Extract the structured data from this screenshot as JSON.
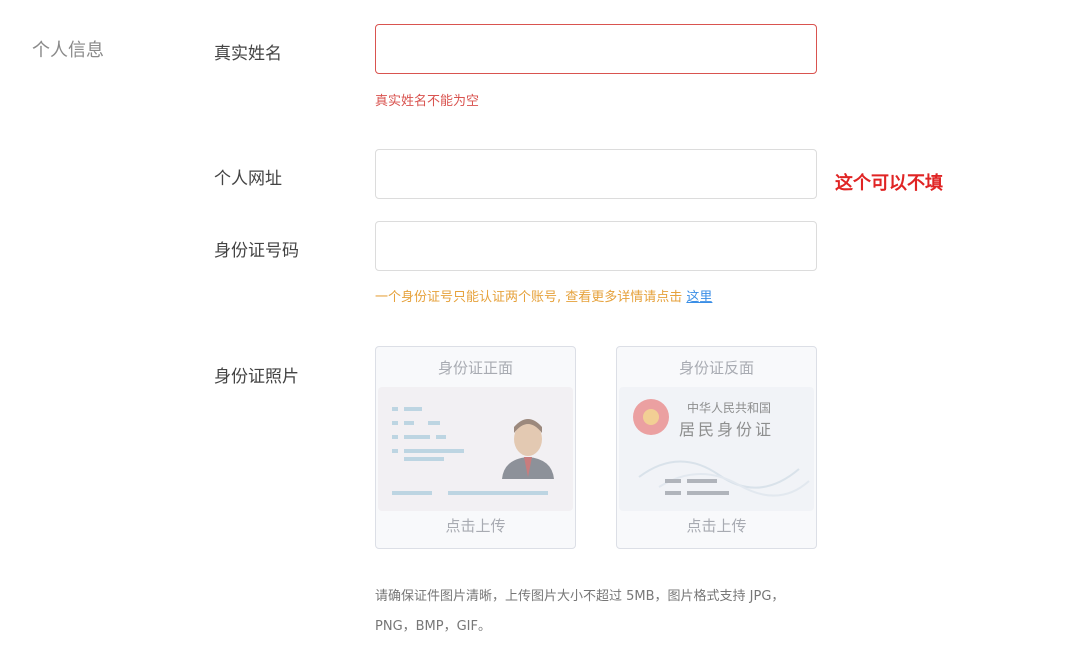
{
  "section": {
    "title": "个人信息"
  },
  "fields": {
    "real_name": {
      "label": "真实姓名",
      "value": "",
      "error": "真实姓名不能为空"
    },
    "website": {
      "label": "个人网址",
      "value": "",
      "annotation": "这个可以不填"
    },
    "id_number": {
      "label": "身份证号码",
      "value": "",
      "hint_text": "一个身份证号只能认证两个账号, 查看更多详情请点击",
      "hint_link": "这里"
    },
    "id_photos": {
      "label": "身份证照片",
      "front": {
        "title": "身份证正面",
        "action": "点击上传"
      },
      "back": {
        "title": "身份证反面",
        "action": "点击上传",
        "card_line1": "中华人民共和国",
        "card_line2": "居民身份证"
      },
      "note": "请确保证件图片清晰，上传图片大小不超过 5MB，图片格式支持 JPG，PNG，BMP，GIF。"
    }
  },
  "colors": {
    "error": "#d9534f",
    "annotation": "#e02424",
    "hint": "#e6a23c",
    "link": "#3a8ee6"
  },
  "icons": {
    "front_sample": "id-card-front-icon",
    "back_sample": "id-card-back-icon"
  }
}
